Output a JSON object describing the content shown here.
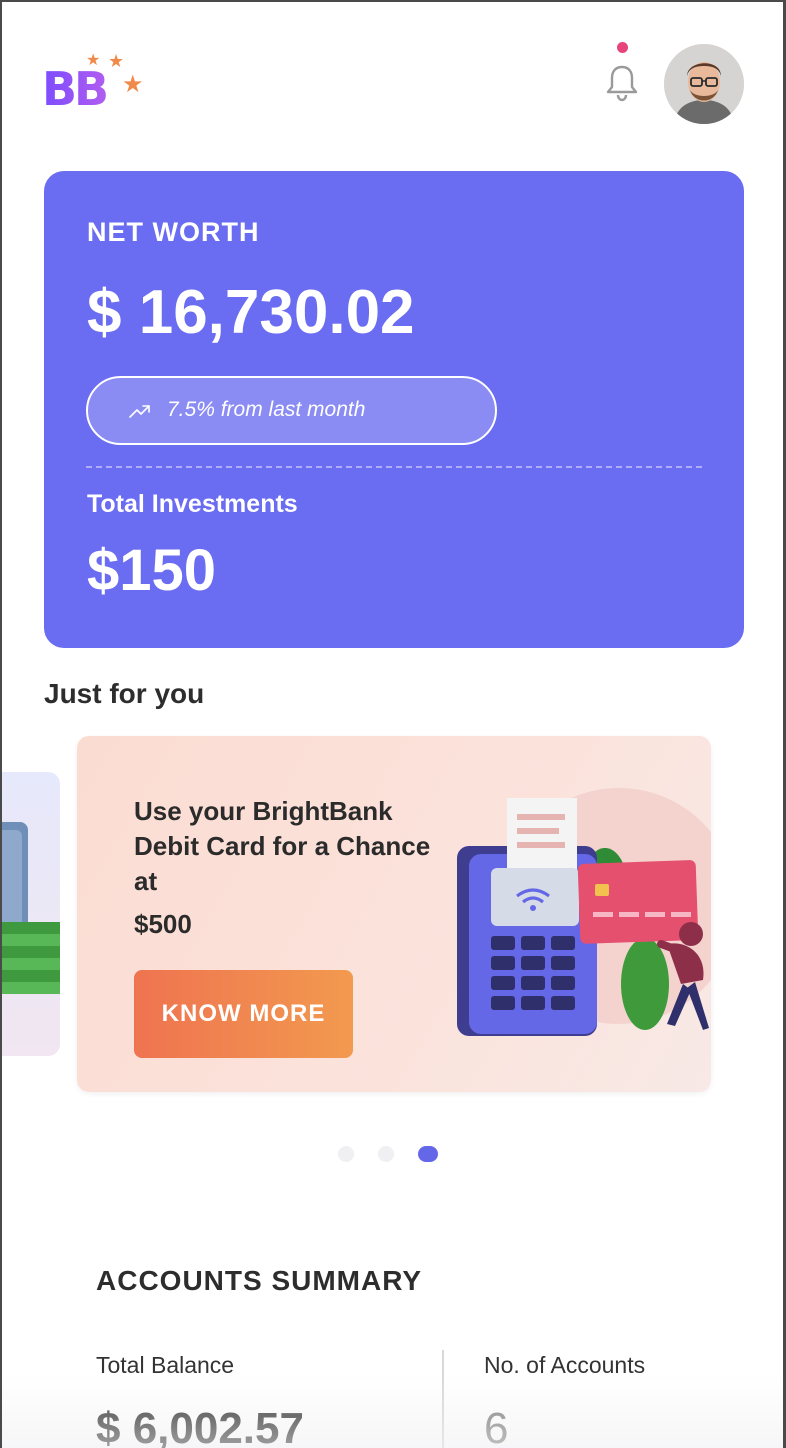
{
  "header": {
    "logo_text": "BB",
    "avatar_alt": "user avatar"
  },
  "net_worth": {
    "label": "NET WORTH",
    "amount": "$ 16,730.02",
    "change_text": "7.5% from last month",
    "investments_label": "Total Investments",
    "investments_amount": "$150"
  },
  "just_for_you": {
    "title": "Just for you",
    "promo": {
      "title": "Use your BrightBank Debit Card for a Chance at",
      "amount": "$500",
      "button_label": "KNOW MORE"
    },
    "carousel": {
      "total": 3,
      "active_index": 2
    }
  },
  "accounts_summary": {
    "title": "ACCOUNTS SUMMARY",
    "total_balance_label": "Total Balance",
    "total_balance_value": "$ 6,002.57",
    "accounts_label": "No. of Accounts",
    "accounts_value": "6"
  },
  "colors": {
    "card": "#6a6cf1",
    "accent_orange": "#ef7350",
    "notification_dot": "#e7457a",
    "carousel_active": "#6468e8"
  }
}
